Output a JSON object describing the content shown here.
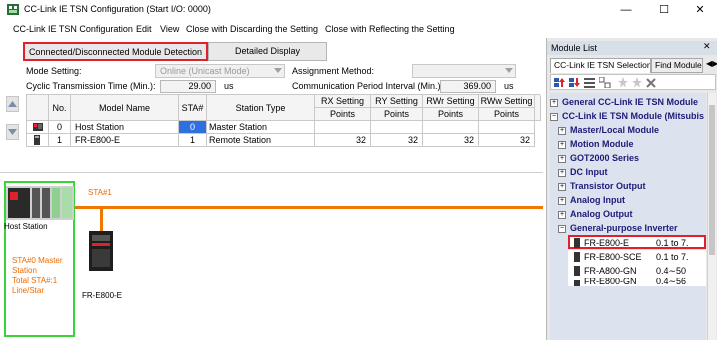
{
  "window": {
    "title": "CC-Link IE TSN Configuration (Start I/O: 0000)",
    "minimize": "—",
    "maximize": "☐",
    "close": "✕"
  },
  "menu": {
    "items": [
      "CC-Link IE TSN Configuration",
      "Edit",
      "View",
      "Close with Discarding the Setting",
      "Close with Reflecting the Setting"
    ]
  },
  "tabs": {
    "detection": "Connected/Disconnected Module Detection",
    "detailed": "Detailed Display"
  },
  "settings": {
    "mode_label": "Mode Setting:",
    "mode_value": "Online (Unicast Mode)",
    "assign_label": "Assignment Method:",
    "assign_value": "",
    "cyclic_label": "Cyclic Transmission Time (Min.):",
    "cyclic_value": "29.00",
    "cyclic_unit": "us",
    "comm_label": "Communication Period Interval (Min.):",
    "comm_value": "369.00",
    "comm_unit": "us"
  },
  "table": {
    "headers": {
      "no": "No.",
      "model": "Model Name",
      "sta": "STA#",
      "type": "Station Type",
      "rx": "RX Setting",
      "ry": "RY Setting",
      "rwr": "RWr Setting",
      "rww": "RWw Setting",
      "points": "Points"
    },
    "rows": [
      {
        "no": "0",
        "model": "Host Station",
        "sta": "0",
        "type": "Master Station",
        "rx": "",
        "ry": "",
        "rwr": "",
        "rww": ""
      },
      {
        "no": "1",
        "model": "FR-E800-E",
        "sta": "1",
        "type": "Remote Station",
        "rx": "32",
        "ry": "32",
        "rwr": "32",
        "rww": "32"
      }
    ]
  },
  "network": {
    "host_label": "Host Station",
    "host_info": [
      "STA#0  Master Station",
      "Total STA#:1",
      "Line/Star"
    ],
    "sta_label": "STA#1",
    "device_label": "FR-E800-E"
  },
  "module_list": {
    "title": "Module List",
    "tab1": "CC-Link IE TSN Selection",
    "tab2": "Find Module",
    "categories": [
      {
        "label": "General CC-Link IE TSN Module",
        "sign": "+"
      },
      {
        "label": "CC-Link IE TSN Module (Mitsubishi",
        "sign": "−"
      },
      {
        "label": "Master/Local Module",
        "sign": "+"
      },
      {
        "label": "Motion Module",
        "sign": "+"
      },
      {
        "label": "GOT2000 Series",
        "sign": "+"
      },
      {
        "label": "DC Input",
        "sign": "+"
      },
      {
        "label": "Transistor Output",
        "sign": "+"
      },
      {
        "label": "Analog Input",
        "sign": "+"
      },
      {
        "label": "Analog Output",
        "sign": "+"
      },
      {
        "label": "General-purpose Inverter",
        "sign": "−"
      }
    ],
    "items": [
      {
        "name": "FR-E800-E",
        "spec": "0.1 to 7."
      },
      {
        "name": "FR-E800-SCE",
        "spec": "0.1 to 7."
      },
      {
        "name": "FR-A800-GN",
        "spec": "0.4∼50"
      },
      {
        "name": "FR-E800-GN",
        "spec": "0.4∼56"
      }
    ]
  },
  "colors": {
    "highlight_red": "#e0202a",
    "network_orange": "#f07800",
    "host_green": "#3ad43a",
    "category_blue": "#1c1c78",
    "sta_selected": "#2f6fe0"
  }
}
